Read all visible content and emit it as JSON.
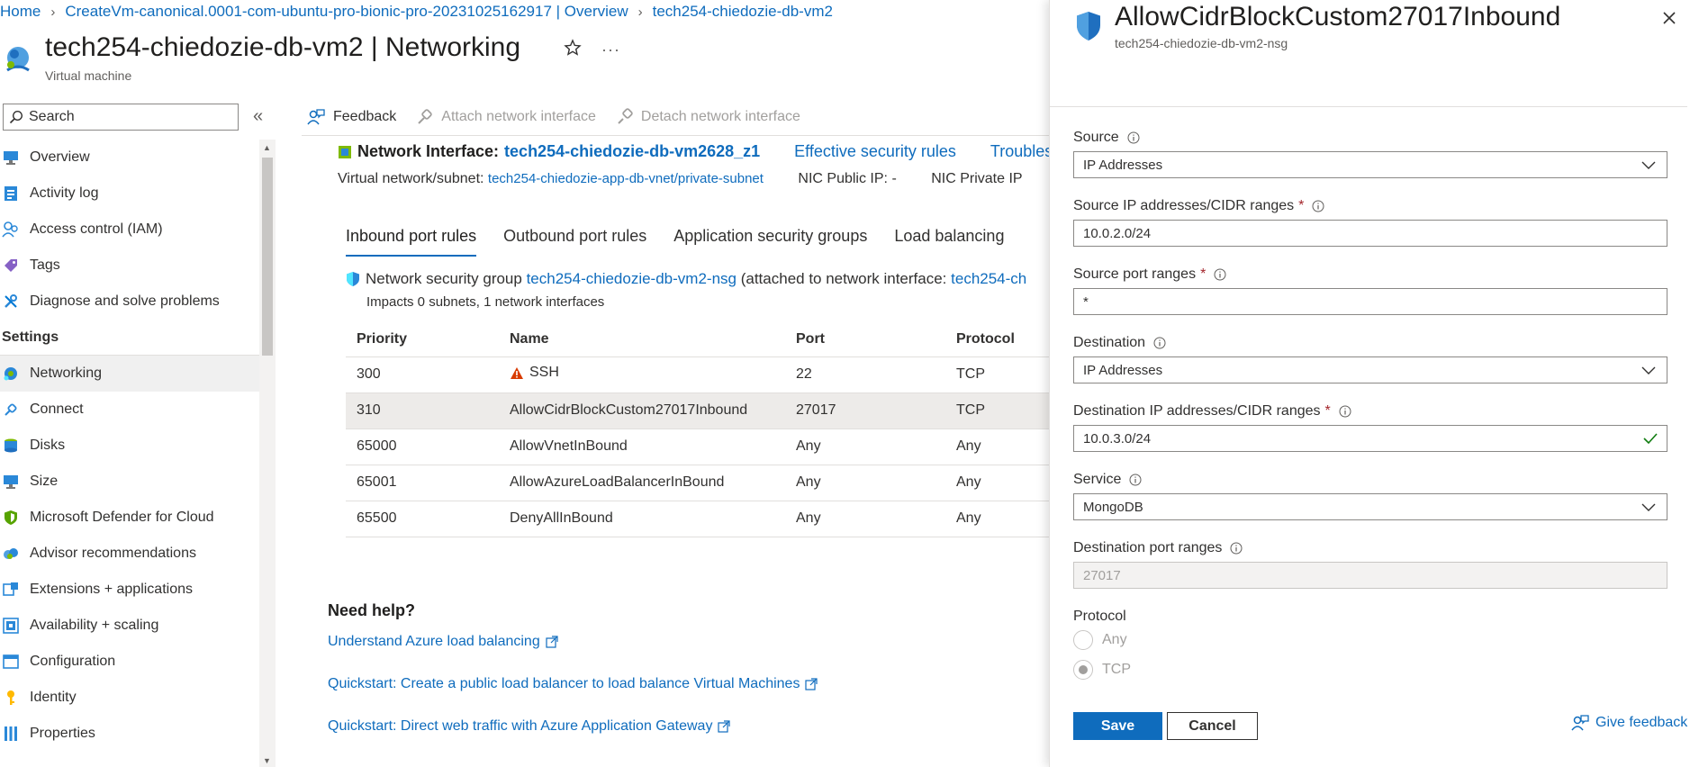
{
  "breadcrumb": {
    "items": [
      "Home",
      "CreateVm-canonical.0001-com-ubuntu-pro-bionic-pro-20231025162917 | Overview",
      "tech254-chiedozie-db-vm2"
    ]
  },
  "header": {
    "title": "tech254-chiedozie-db-vm2 | Networking",
    "subtitle": "Virtual machine"
  },
  "search": {
    "placeholder": "Search"
  },
  "sidebar": {
    "items_top": [
      {
        "label": "Overview",
        "icon": "monitor-icon"
      },
      {
        "label": "Activity log",
        "icon": "activity-log-icon"
      },
      {
        "label": "Access control (IAM)",
        "icon": "people-icon"
      },
      {
        "label": "Tags",
        "icon": "tag-icon"
      },
      {
        "label": "Diagnose and solve problems",
        "icon": "wrench-icon"
      }
    ],
    "section": "Settings",
    "items_settings": [
      {
        "label": "Networking",
        "icon": "network-icon",
        "active": true
      },
      {
        "label": "Connect",
        "icon": "plug-icon"
      },
      {
        "label": "Disks",
        "icon": "disks-icon"
      },
      {
        "label": "Size",
        "icon": "monitor-icon"
      },
      {
        "label": "Microsoft Defender for Cloud",
        "icon": "shield-icon"
      },
      {
        "label": "Advisor recommendations",
        "icon": "cloud-icon"
      },
      {
        "label": "Extensions + applications",
        "icon": "extensions-icon"
      },
      {
        "label": "Availability + scaling",
        "icon": "scaling-icon"
      },
      {
        "label": "Configuration",
        "icon": "config-icon"
      },
      {
        "label": "Identity",
        "icon": "key-icon"
      },
      {
        "label": "Properties",
        "icon": "properties-icon"
      }
    ]
  },
  "toolbar": {
    "feedback": "Feedback",
    "attach": "Attach network interface",
    "detach": "Detach network interface"
  },
  "nic": {
    "label": "Network Interface:",
    "name": "tech254-chiedozie-db-vm2628_z1",
    "effective_rules": "Effective security rules",
    "troubleshoot": "Troublesho",
    "vnet_label": "Virtual network/subnet:",
    "vnet_value": "tech254-chiedozie-app-db-vnet/private-subnet",
    "public_ip": "NIC Public IP: -",
    "private_ip": "NIC Private IP"
  },
  "tabs": [
    "Inbound port rules",
    "Outbound port rules",
    "Application security groups",
    "Load balancing"
  ],
  "nsg": {
    "prefix": "Network security group",
    "name": "tech254-chiedozie-db-vm2-nsg",
    "attached": "(attached to network interface:",
    "attached_link": "tech254-ch",
    "impacts": "Impacts 0 subnets, 1 network interfaces"
  },
  "rules_table": {
    "headers": [
      "Priority",
      "Name",
      "Port",
      "Protocol"
    ],
    "rows": [
      {
        "priority": "300",
        "name": "SSH",
        "port": "22",
        "protocol": "TCP",
        "warning": true
      },
      {
        "priority": "310",
        "name": "AllowCidrBlockCustom27017Inbound",
        "port": "27017",
        "protocol": "TCP",
        "selected": true
      },
      {
        "priority": "65000",
        "name": "AllowVnetInBound",
        "port": "Any",
        "protocol": "Any"
      },
      {
        "priority": "65001",
        "name": "AllowAzureLoadBalancerInBound",
        "port": "Any",
        "protocol": "Any"
      },
      {
        "priority": "65500",
        "name": "DenyAllInBound",
        "port": "Any",
        "protocol": "Any"
      }
    ]
  },
  "help": {
    "title": "Need help?",
    "links": [
      "Understand Azure load balancing",
      "Quickstart: Create a public load balancer to load balance Virtual Machines",
      "Quickstart: Direct web traffic with Azure Application Gateway"
    ]
  },
  "panel": {
    "title": "AllowCidrBlockCustom27017Inbound",
    "subtitle": "tech254-chiedozie-db-vm2-nsg",
    "source_label": "Source",
    "source_value": "IP Addresses",
    "source_ip_label": "Source IP addresses/CIDR ranges",
    "source_ip_value": "10.0.2.0/24",
    "source_port_label": "Source port ranges",
    "source_port_value": "*",
    "dest_label": "Destination",
    "dest_value": "IP Addresses",
    "dest_ip_label": "Destination IP addresses/CIDR ranges",
    "dest_ip_value": "10.0.3.0/24",
    "service_label": "Service",
    "service_value": "MongoDB",
    "dest_port_label": "Destination port ranges",
    "dest_port_value": "27017",
    "protocol_label": "Protocol",
    "protocol_options": [
      "Any",
      "TCP"
    ],
    "protocol_selected": "TCP",
    "save": "Save",
    "cancel": "Cancel",
    "give_feedback": "Give feedback",
    "required_mark": "*"
  },
  "colors": {
    "accent": "#0f6cbd",
    "warning": "#d83b01",
    "success": "#107c10",
    "required": "#a4262c"
  }
}
